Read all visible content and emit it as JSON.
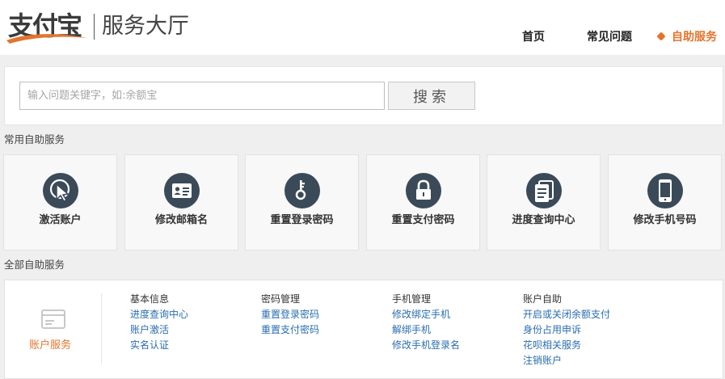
{
  "header": {
    "logo_text": "支付宝",
    "title": "服务大厅",
    "nav": [
      {
        "label": "首页"
      },
      {
        "label": "常见问题"
      },
      {
        "label": "自助服务"
      }
    ]
  },
  "search": {
    "placeholder": "输入问题关键字，如:余额宝",
    "value": "",
    "button_label": "搜索"
  },
  "common_section": {
    "title": "常用自助服务",
    "cards": [
      {
        "label": "激活账户",
        "icon": "cursor-click-icon"
      },
      {
        "label": "修改邮箱名",
        "icon": "id-card-icon"
      },
      {
        "label": "重置登录密码",
        "icon": "key-icon"
      },
      {
        "label": "重置支付密码",
        "icon": "lock-icon"
      },
      {
        "label": "进度查询中心",
        "icon": "documents-icon"
      },
      {
        "label": "修改手机号码",
        "icon": "mobile-phone-icon"
      }
    ]
  },
  "all_section": {
    "title": "全部自助服务",
    "category": {
      "label": "账户服务",
      "icon": "account-card-icon"
    },
    "columns": [
      {
        "heading": "基本信息",
        "links": [
          "进度查询中心",
          "账户激活",
          "实名认证"
        ]
      },
      {
        "heading": "密码管理",
        "links": [
          "重置登录密码",
          "重置支付密码"
        ]
      },
      {
        "heading": "手机管理",
        "links": [
          "修改绑定手机",
          "解绑手机",
          "修改手机登录名"
        ]
      },
      {
        "heading": "账户自助",
        "links": [
          "开启或关闭余额支付",
          "身份占用申诉",
          "花呗相关服务",
          "注销账户"
        ]
      }
    ]
  },
  "colors": {
    "accent": "#e3742c",
    "icon_circle": "#3b4a58",
    "link": "#2a6db0"
  }
}
